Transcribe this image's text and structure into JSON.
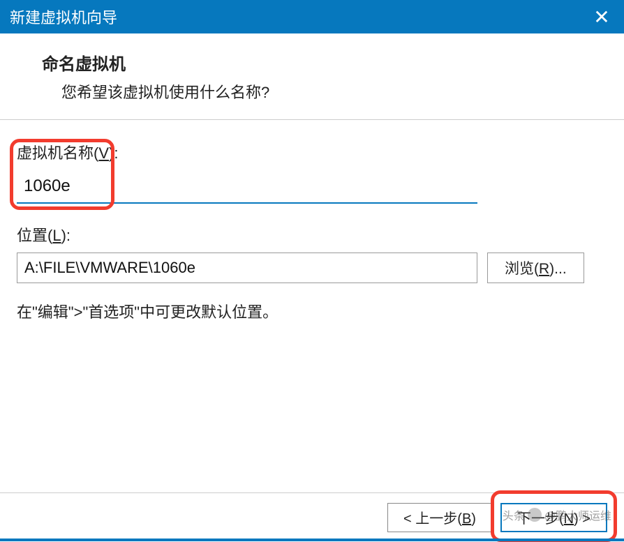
{
  "titlebar": {
    "title": "新建虚拟机向导",
    "close": "✕"
  },
  "header": {
    "title": "命名虚拟机",
    "subtitle": "您希望该虚拟机使用什么名称?"
  },
  "fields": {
    "name_label_prefix": "虚拟机名称(",
    "name_label_mnemonic": "V",
    "name_label_suffix": "):",
    "name_value": "1060e",
    "location_label_prefix": "位置(",
    "location_label_mnemonic": "L",
    "location_label_suffix": "):",
    "location_value": "A:\\FILE\\VMWARE\\1060e",
    "browse_prefix": "浏览(",
    "browse_mnemonic": "R",
    "browse_suffix": ")...",
    "hint": "在\"编辑\">\"首选项\"中可更改默认位置。"
  },
  "footer": {
    "back_prefix": "< 上一步(",
    "back_mnemonic": "B",
    "back_suffix": ")",
    "next_prefix": "下一步(",
    "next_mnemonic": "N",
    "next_suffix": ") >"
  },
  "watermark": {
    "text1": "头条",
    "text2": "@鹏大师运维"
  }
}
